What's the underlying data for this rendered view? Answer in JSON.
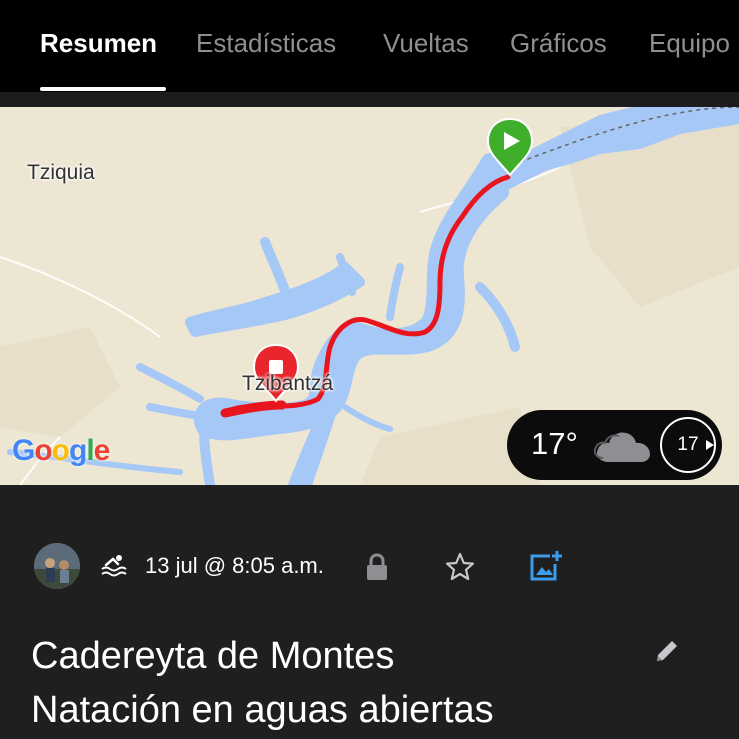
{
  "tabs": [
    {
      "label": "Resumen",
      "active": true
    },
    {
      "label": "Estadísticas",
      "active": false
    },
    {
      "label": "Vueltas",
      "active": false
    },
    {
      "label": "Gráficos",
      "active": false
    },
    {
      "label": "Equipo",
      "active": false
    }
  ],
  "map": {
    "places": [
      "Tziquia",
      "Tzibantzá"
    ],
    "attribution": {
      "letters": [
        "G",
        "o",
        "o",
        "g",
        "l",
        "e"
      ],
      "colors": [
        "#4285f4",
        "#ea4335",
        "#fbbc05",
        "#4285f4",
        "#34a853",
        "#ea4335"
      ]
    },
    "colors": {
      "land": "#ede6d2",
      "water": "#a6c8f6",
      "route": "#e8141e",
      "start_marker": "#3fae2a",
      "end_marker": "#e8262c"
    },
    "weather": {
      "temperature": "17°",
      "condition_icon": "cloud-icon",
      "wind_speed": "17"
    }
  },
  "activity": {
    "sport_icon": "swim-icon",
    "date": "13 jul @ 8:05 a.m.",
    "privacy_icon": "lock-icon",
    "title_line1": "Cadereyta de Montes",
    "title_line2": "Natación en aguas abiertas",
    "colors": {
      "accent": "#3c9bea"
    }
  }
}
